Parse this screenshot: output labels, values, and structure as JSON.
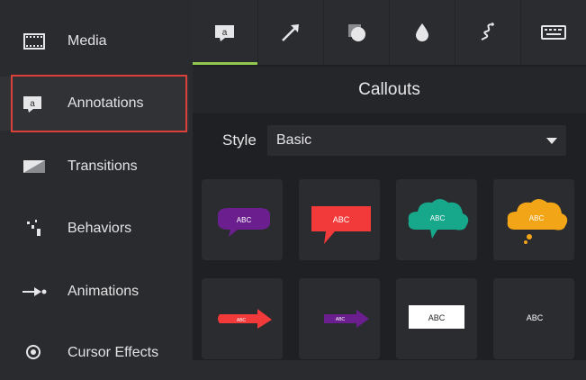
{
  "sidebar": {
    "items": [
      {
        "label": "Media",
        "icon": "film-icon"
      },
      {
        "label": "Annotations",
        "icon": "annotation-icon",
        "selected": true
      },
      {
        "label": "Transitions",
        "icon": "transition-icon"
      },
      {
        "label": "Behaviors",
        "icon": "behaviors-icon"
      },
      {
        "label": "Animations",
        "icon": "animation-arrow-icon"
      },
      {
        "label": "Cursor Effects",
        "icon": "cursor-effects-icon"
      }
    ]
  },
  "tabs": [
    {
      "icon": "callout-icon",
      "active": true
    },
    {
      "icon": "arrow-icon"
    },
    {
      "icon": "shape-icon"
    },
    {
      "icon": "blur-drop-icon"
    },
    {
      "icon": "sketch-motion-icon"
    },
    {
      "icon": "keyboard-icon"
    }
  ],
  "section": {
    "title": "Callouts"
  },
  "style": {
    "label": "Style",
    "value": "Basic"
  },
  "tiles": [
    {
      "text": "ABC",
      "kind": "speech-bubble",
      "color": "#6b1f8f"
    },
    {
      "text": "ABC",
      "kind": "rect-bubble",
      "color": "#f23a3a"
    },
    {
      "text": "ABC",
      "kind": "cloud",
      "color": "#17a88c"
    },
    {
      "text": "ABC",
      "kind": "thought-cloud",
      "color": "#f2a516"
    },
    {
      "text": "ABC",
      "kind": "arrow",
      "color": "#f23a3a"
    },
    {
      "text": "ABC",
      "kind": "arrow",
      "color": "#6b1f8f"
    },
    {
      "text": "ABC",
      "kind": "box",
      "color": "#ffffff"
    },
    {
      "text": "ABC",
      "kind": "text",
      "color": "#ffffff"
    }
  ],
  "colors": {
    "accent": "#92c84d",
    "highlight": "#d9403a"
  }
}
